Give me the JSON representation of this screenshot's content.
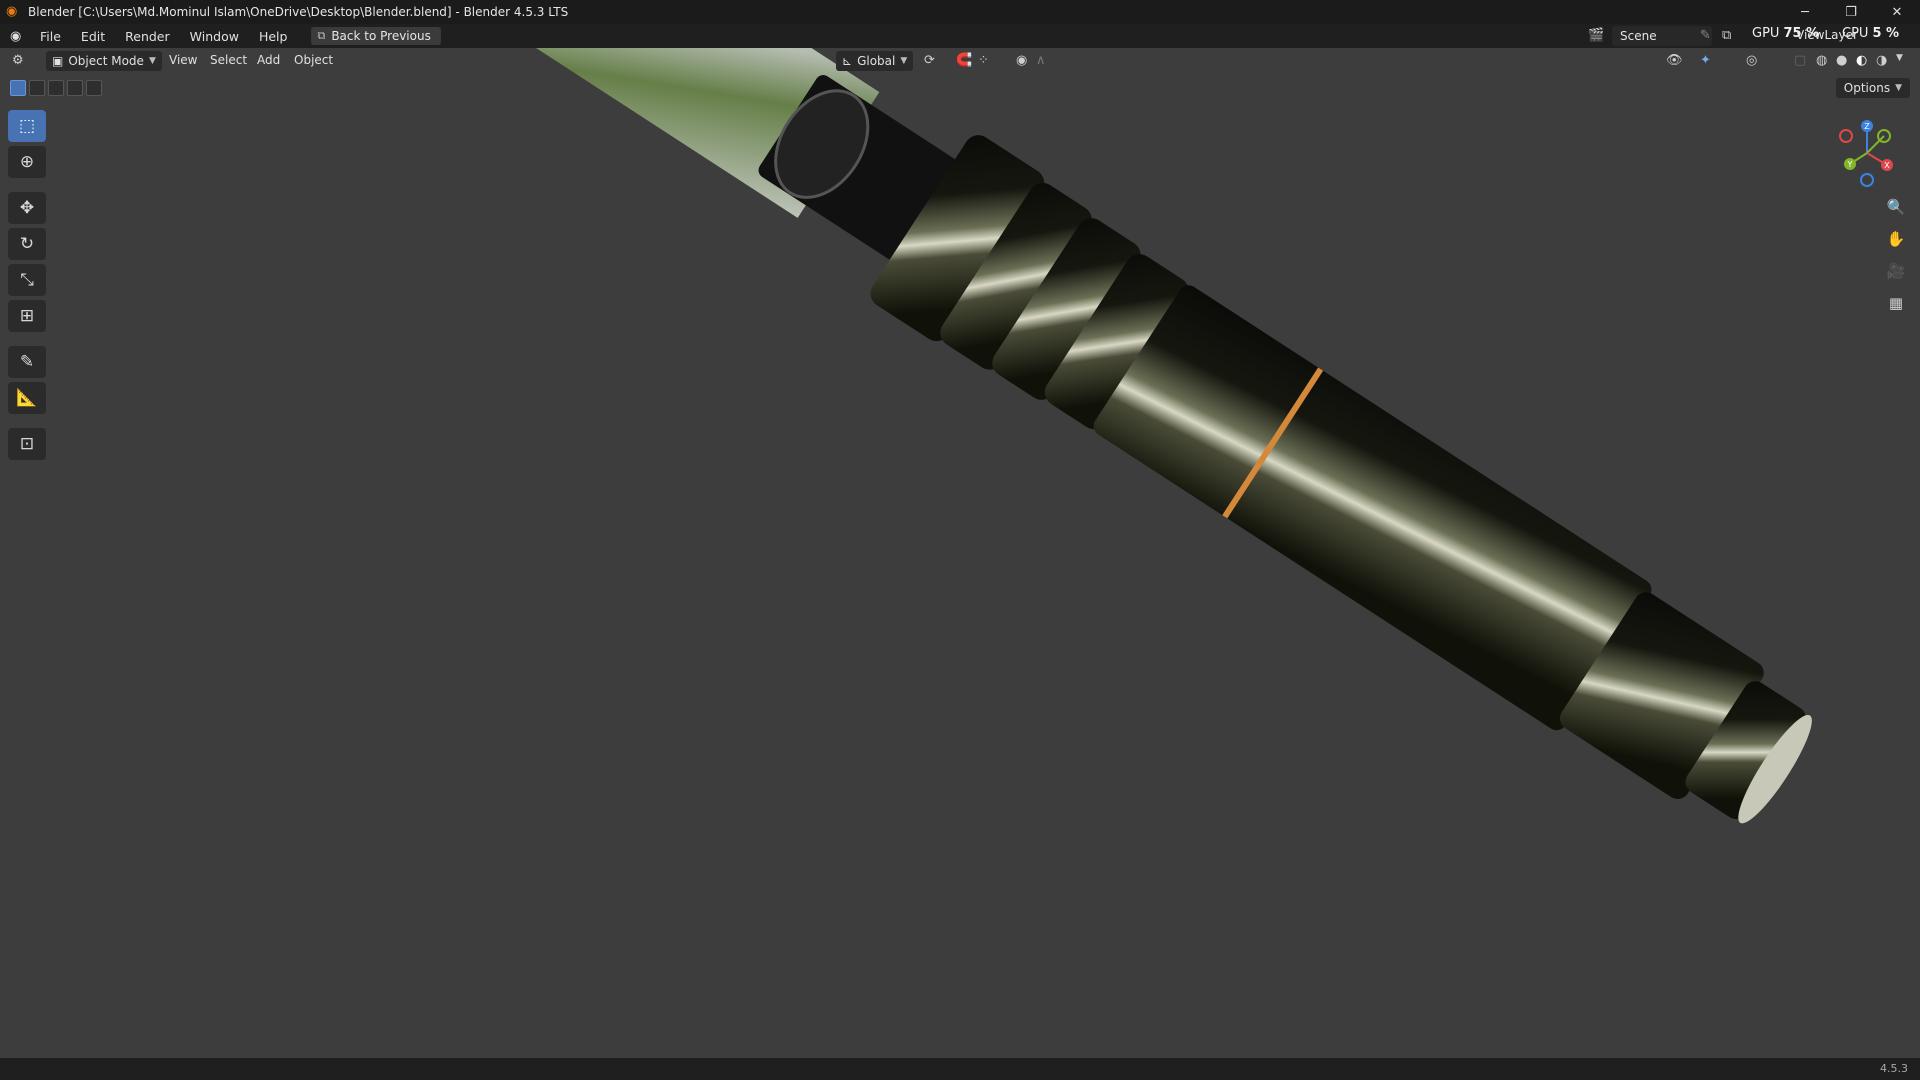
{
  "window": {
    "title": "Blender [C:\\Users\\Md.Mominul Islam\\OneDrive\\Desktop\\Blender.blend] - Blender 4.5.3 LTS",
    "app_icon": "blender-icon",
    "controls": {
      "minimize": "─",
      "restore": "❐",
      "close": "✕"
    }
  },
  "menu": {
    "items": [
      "File",
      "Edit",
      "Render",
      "Window",
      "Help"
    ],
    "back_button": "Back to Previous"
  },
  "stats": {
    "gpu_label": "GPU",
    "gpu_value": "75 %",
    "cpu_label": "CPU",
    "cpu_value": "5 %"
  },
  "scene": {
    "scene_name": "Scene",
    "view_layer": "ViewLayer"
  },
  "viewport_header": {
    "mode": "Object Mode",
    "menus": [
      "View",
      "Select",
      "Add",
      "Object"
    ],
    "transform_orientation": "Global",
    "options_label": "Options"
  },
  "toolbar": {
    "tools": [
      {
        "name": "select-box-tool",
        "icon": "select-box-icon",
        "active": true
      },
      {
        "name": "cursor-tool",
        "icon": "cursor-icon",
        "active": false
      },
      {
        "name": "move-tool",
        "icon": "move-icon",
        "active": false
      },
      {
        "name": "rotate-tool",
        "icon": "rotate-icon",
        "active": false
      },
      {
        "name": "scale-tool",
        "icon": "scale-icon",
        "active": false
      },
      {
        "name": "transform-tool",
        "icon": "transform-icon",
        "active": false
      },
      {
        "name": "annotate-tool",
        "icon": "annotate-icon",
        "active": false
      },
      {
        "name": "measure-tool",
        "icon": "measure-icon",
        "active": false
      },
      {
        "name": "add-cube-tool",
        "icon": "add-cube-icon",
        "active": false
      }
    ]
  },
  "gizmo": {
    "z": "Z",
    "y": "Y",
    "x": "X",
    "colors": {
      "x": "#e0474d",
      "y": "#83b529",
      "z": "#3b83e0"
    }
  },
  "status": {
    "version": "4.5.3"
  },
  "colors": {
    "active_tool": "#4772b3",
    "background": "#3d3d3d",
    "accent_ring": "#d4883a"
  }
}
